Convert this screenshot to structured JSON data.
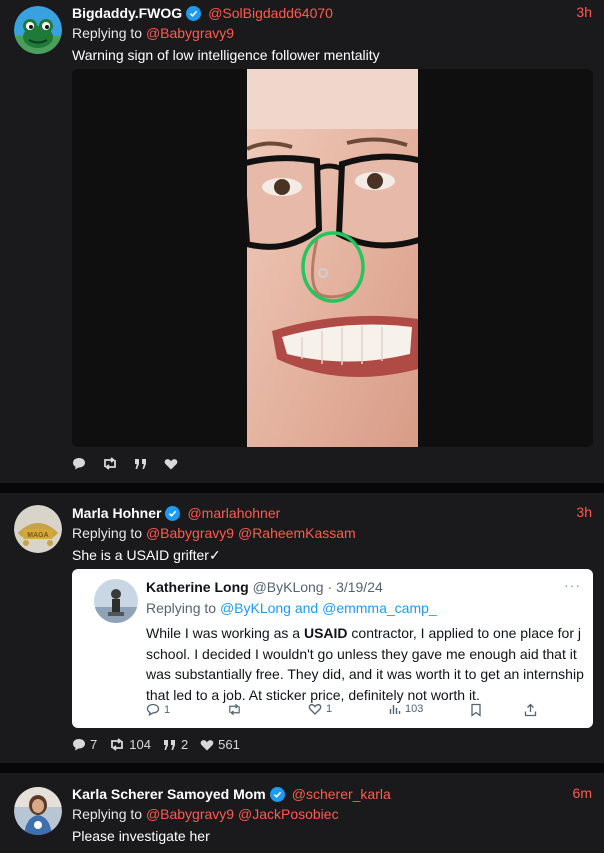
{
  "posts": [
    {
      "name": "Bigdaddy.FWOG",
      "handle": "@SolBigdadd64070",
      "time": "3h",
      "replying_label": "Replying to",
      "replying_to": [
        "@Babygravy9"
      ],
      "text": "Warning sign of low intelligence follower mentality",
      "stats": {
        "replies": "",
        "reposts": "",
        "quotes": "",
        "likes": ""
      }
    },
    {
      "name": "Marla Hohner",
      "handle": "@marlahohner",
      "time": "3h",
      "replying_label": "Replying to",
      "replying_to": [
        "@Babygravy9",
        "@RaheemKassam"
      ],
      "text": "She is a USAID grifter✓",
      "quoted": {
        "name": "Katherine Long",
        "handle": "@ByKLong",
        "date": "3/19/24",
        "more": "···",
        "replying_label": "Replying to",
        "replying_to": "@ByKLong and @emmma_camp_",
        "body_pre": "While I was working as a ",
        "body_bold": "USAID",
        "body_post": " contractor, I applied to one place for j school. I decided I wouldn't go unless they gave me enough aid that it was substantially free. They did, and it was worth it to get an internship that led to a job. At sticker price, definitely not worth it.",
        "stats": {
          "replies": "1",
          "reposts": "",
          "likes": "1",
          "views": "103"
        }
      },
      "stats": {
        "replies": "7",
        "reposts": "104",
        "quotes": "2",
        "likes": "561"
      }
    },
    {
      "name": "Karla Scherer Samoyed Mom",
      "handle": "@scherer_karla",
      "time": "6m",
      "replying_label": "Replying to",
      "replying_to": [
        "@Babygravy9",
        "@JackPosobiec"
      ],
      "text": "Please investigate her"
    }
  ],
  "colors": {
    "accent": "#ff5a4e",
    "verified": "#1d9bf0",
    "card_bg": "#1a1a1d"
  },
  "icons": [
    "reply-icon",
    "repost-icon",
    "quote-icon",
    "like-icon",
    "verified-badge-icon",
    "views-icon",
    "bookmark-icon",
    "share-icon"
  ]
}
